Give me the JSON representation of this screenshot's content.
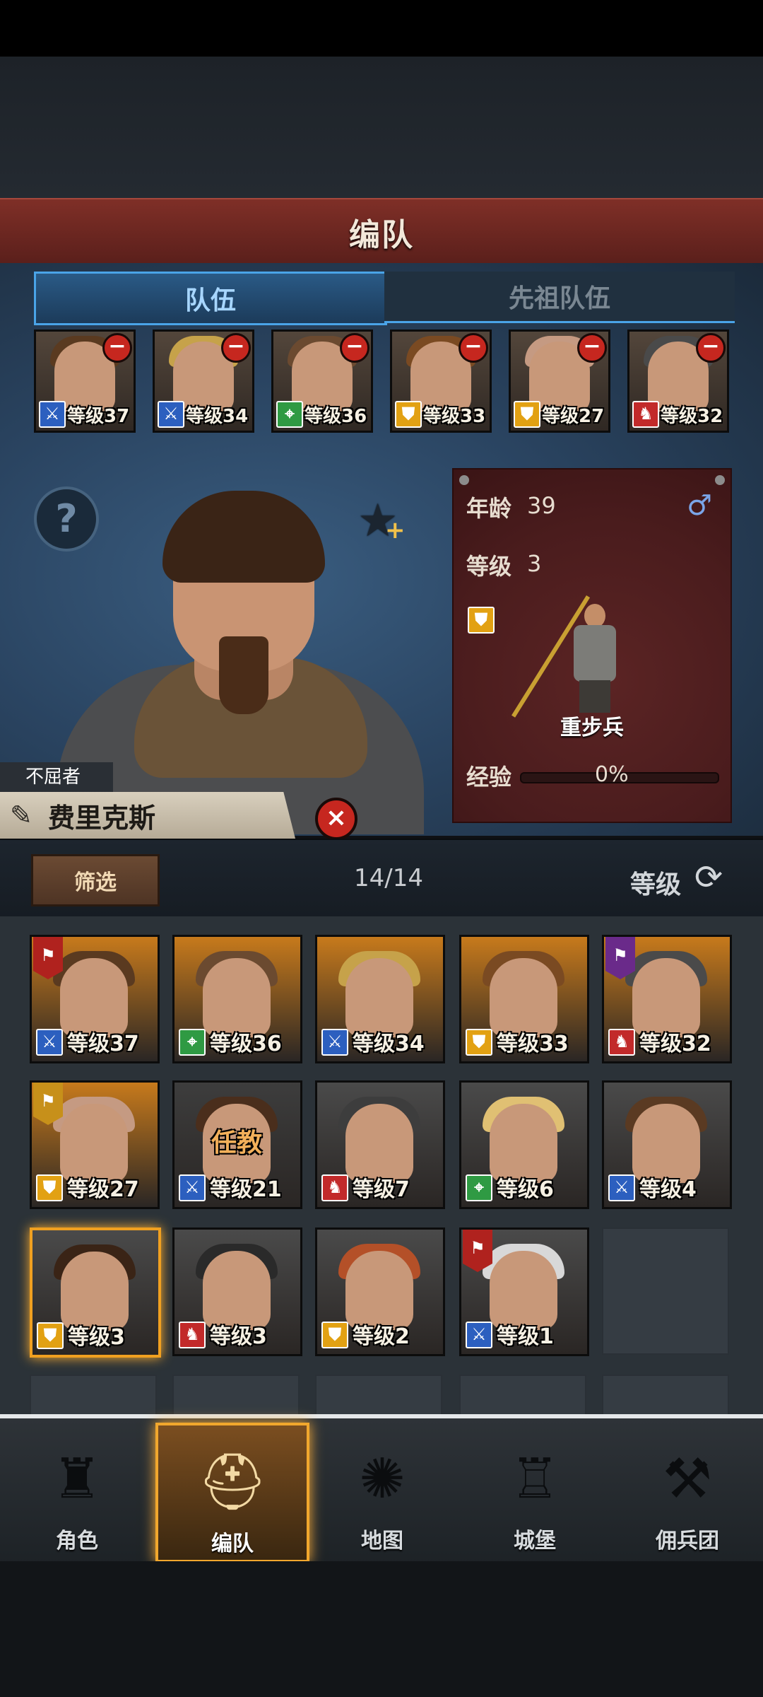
{
  "header": {
    "title": "编队"
  },
  "tabs": [
    {
      "label": "队伍",
      "active": true
    },
    {
      "label": "先祖队伍",
      "active": false
    }
  ],
  "team": [
    {
      "class": "sword",
      "level": "等级37",
      "hair": "#5a3a20"
    },
    {
      "class": "sword",
      "level": "等级34",
      "hair": "#c6a24a"
    },
    {
      "class": "bow",
      "level": "等级36",
      "hair": "#6b4a30"
    },
    {
      "class": "shield",
      "level": "等级33",
      "hair": "#7a4a22"
    },
    {
      "class": "shield",
      "level": "等级27",
      "hair": "#c59a82"
    },
    {
      "class": "beast",
      "level": "等级32",
      "hair": "#4a4a4a"
    }
  ],
  "hero": {
    "title": "不屈者",
    "name": "费里克斯",
    "age_label": "年龄",
    "age": "39",
    "level_label": "等级",
    "level": "3",
    "gender_icon": "male-icon",
    "unit_type": "重步兵",
    "exp_label": "经验",
    "exp": "0%"
  },
  "filter": {
    "button": "筛选",
    "count": "14/14",
    "sort_label": "等级"
  },
  "roster": [
    {
      "class": "sword",
      "level": "等级37",
      "bg": "#c77a1c",
      "hair": "#5a3a20",
      "banner": "#b0221e"
    },
    {
      "class": "bow",
      "level": "等级36",
      "bg": "#c77a1c",
      "hair": "#6b4a30"
    },
    {
      "class": "sword",
      "level": "等级34",
      "bg": "#c77a1c",
      "hair": "#c6a24a"
    },
    {
      "class": "shield",
      "level": "等级33",
      "bg": "#c77a1c",
      "hair": "#7a4a22"
    },
    {
      "class": "beast",
      "level": "等级32",
      "bg": "#c77a1c",
      "hair": "#4a4a4a",
      "banner": "#6a2a8a"
    },
    {
      "class": "shield",
      "level": "等级27",
      "bg": "#c77a1c",
      "hair": "#c59a82",
      "banner": "#c7901a"
    },
    {
      "class": "sword",
      "level": "等级21",
      "bg": "#3d3d3d",
      "hair": "#4a2e1c",
      "duty": "任教"
    },
    {
      "class": "beast",
      "level": "等级7",
      "bg": "#4a4a4a",
      "hair": "#3d3d3d"
    },
    {
      "class": "bow",
      "level": "等级6",
      "bg": "#4a4a4a",
      "hair": "#e0c073"
    },
    {
      "class": "sword",
      "level": "等级4",
      "bg": "#4a4a4a",
      "hair": "#5a3a22"
    },
    {
      "class": "shield",
      "level": "等级3",
      "bg": "#4a4a4a",
      "hair": "#3a2416",
      "selected": true
    },
    {
      "class": "beast",
      "level": "等级3",
      "bg": "#4a4a4a",
      "hair": "#2a2a2a"
    },
    {
      "class": "shield",
      "level": "等级2",
      "bg": "#4a4a4a",
      "hair": "#b45028"
    },
    {
      "class": "sword",
      "level": "等级1",
      "bg": "#4a4a4a",
      "hair": "#d8d8d8",
      "banner": "#b0221e"
    }
  ],
  "nav": [
    {
      "label": "角色",
      "icon": "knight-icon",
      "active": false
    },
    {
      "label": "编队",
      "icon": "helmet-icon",
      "active": true
    },
    {
      "label": "地图",
      "icon": "compass-map-icon",
      "active": false
    },
    {
      "label": "城堡",
      "icon": "castle-icon",
      "active": false
    },
    {
      "label": "佣兵团",
      "icon": "mercenary-icon",
      "active": false
    }
  ]
}
